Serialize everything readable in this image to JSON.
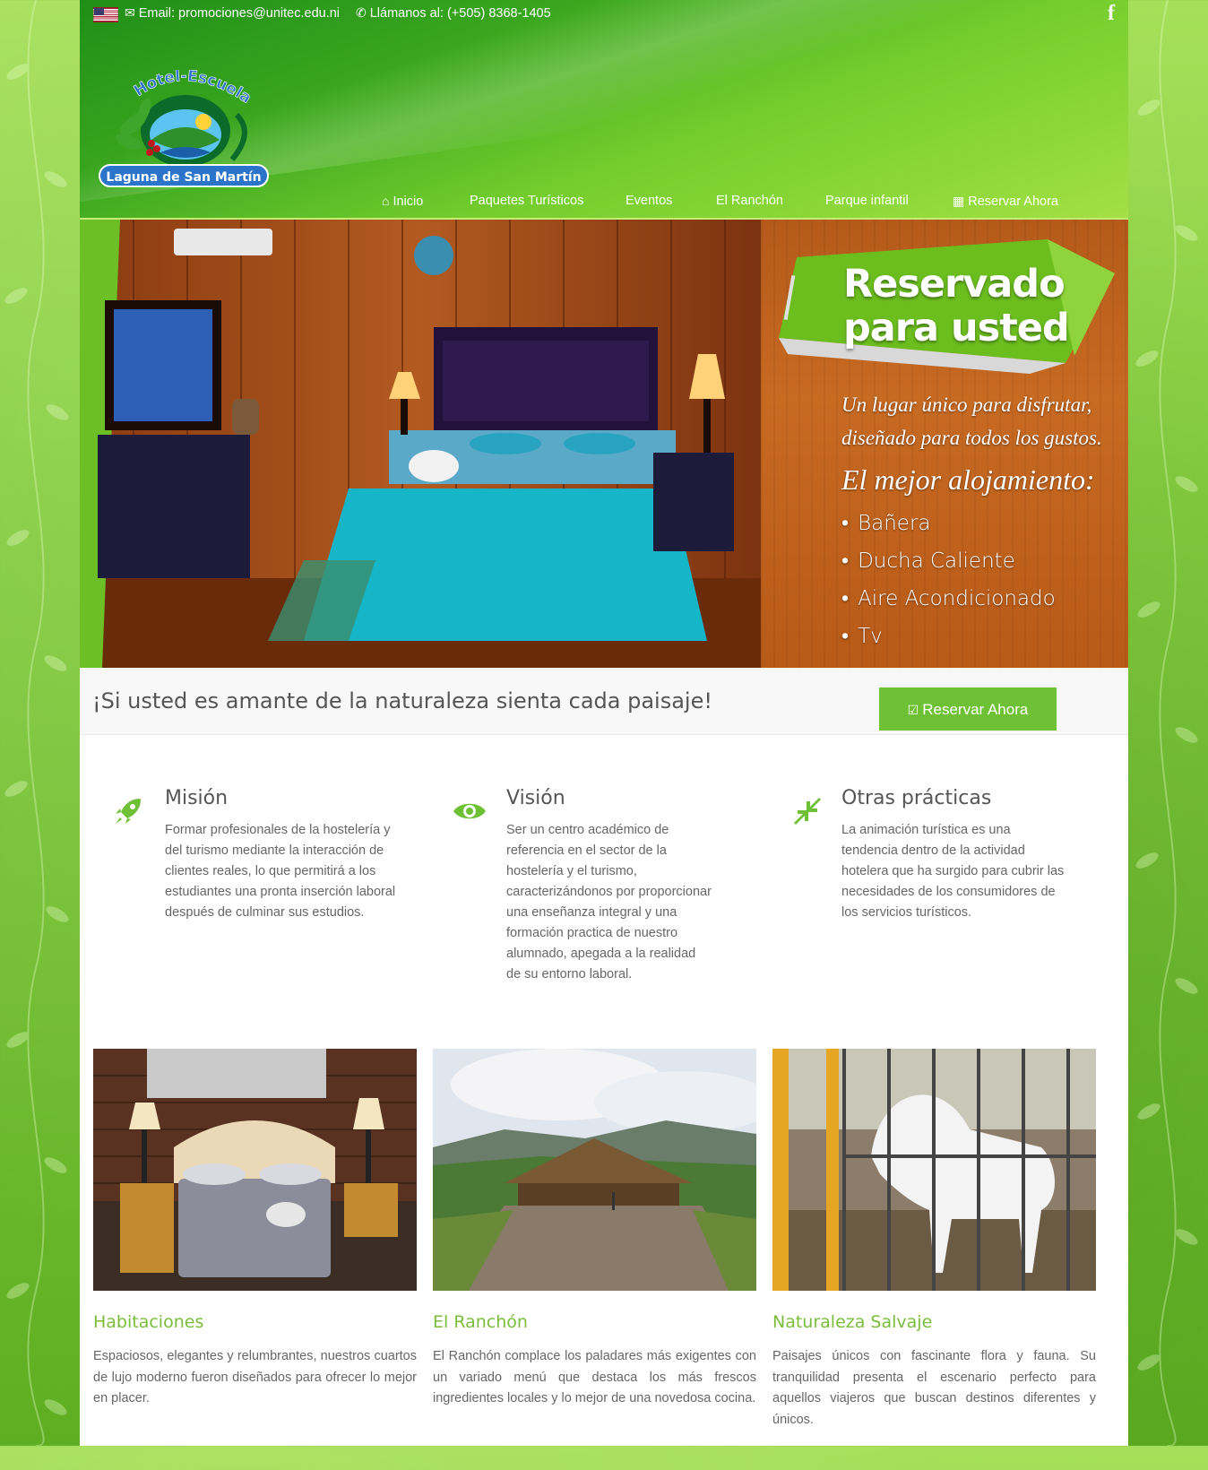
{
  "topbar": {
    "email": "Email: promociones@unitec.edu.ni",
    "phone": "Llámanos al: (+505) 8368-1405"
  },
  "logo": {
    "line1": "Hotel-Escuela",
    "line2": "Laguna de San Martín"
  },
  "nav": {
    "items": [
      {
        "label": "Inicio",
        "icon": "home-icon"
      },
      {
        "label": "Paquetes Turísticos"
      },
      {
        "label": "Eventos"
      },
      {
        "label": "El Ranchón"
      },
      {
        "label": "Parque infantil"
      },
      {
        "label": "Reservar Ahora",
        "icon": "calendar-icon"
      }
    ]
  },
  "hero": {
    "title_line1": "Reservado",
    "title_line2": "para usted",
    "tagline_line1": "Un lugar único para disfrutar,",
    "tagline_line2": "diseñado para todos los gustos.",
    "best": "El mejor alojamiento:",
    "amenities": [
      "Bañera",
      "Ducha Caliente",
      "Aire Acondicionado",
      "Tv"
    ]
  },
  "callout": {
    "text": "¡Si usted es amante de la naturaleza sienta cada paisaje!",
    "button": "Reservar Ahora"
  },
  "features": [
    {
      "icon": "rocket-icon",
      "title": "Misión",
      "text": "Formar profesionales de la hostelería y del turismo mediante la interacción de clientes reales, lo que permitirá a los estudiantes una pronta inserción laboral después de culminar sus estudios."
    },
    {
      "icon": "eye-icon",
      "title": "Visión",
      "text": "Ser un centro académico de referencia en el sector de la hostelería y el turismo, caracterizándonos por proporcionar una enseñanza integral y una formación practica de nuestro alumnado, apegada a la realidad de su entorno laboral."
    },
    {
      "icon": "compress-arrows-icon",
      "title": "Otras prácticas",
      "text": "La animación turística es una tendencia dentro de la actividad hotelera que ha surgido para cubrir las necesidades de los consumidores de los servicios turísticos."
    }
  ],
  "cards": [
    {
      "title": "Habitaciones",
      "text": "Espaciosos, elegantes y relumbrantes, nuestros cuartos de lujo moderno fueron diseñados para ofrecer lo mejor en placer."
    },
    {
      "title": "El Ranchón",
      "text": "El Ranchón complace los paladares más exigentes con un variado menú que destaca los más frescos ingredientes locales y lo mejor de una novedosa cocina."
    },
    {
      "title": "Naturaleza Salvaje",
      "text": "Paisajes únicos  con fascinante flora y fauna. Su tranquilidad presenta el escenario perfecto para aquellos viajeros que buscan destinos diferentes y únicos."
    }
  ],
  "colors": {
    "accent": "#6ec135",
    "header_green": "#3aa61f"
  }
}
